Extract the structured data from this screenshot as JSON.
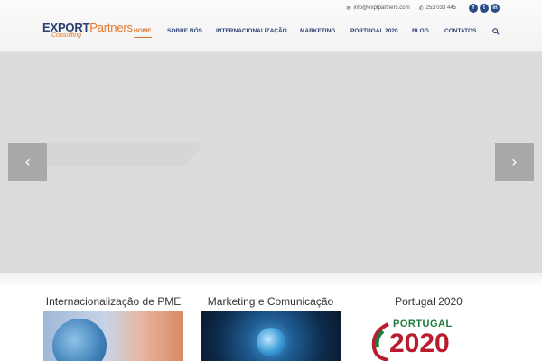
{
  "header": {
    "logo": {
      "export": "EXPORT",
      "partners": "Partners",
      "sub": "Consulting"
    },
    "contact": {
      "email": "info@exptpartners.com",
      "phone": "253 033 445"
    },
    "social": [
      "f",
      "t",
      "in"
    ],
    "nav": [
      {
        "label": "HOME",
        "active": true
      },
      {
        "label": "SOBRE NÓS",
        "active": false
      },
      {
        "label": "INTERNACIONALIZAÇÃO",
        "active": false
      },
      {
        "label": "MARKETING",
        "active": false
      },
      {
        "label": "PORTUGAL 2020",
        "active": false
      },
      {
        "label": "BLOG",
        "active": false
      },
      {
        "label": "CONTATOS",
        "active": false
      }
    ]
  },
  "slider": {
    "prev": "‹",
    "next": "›"
  },
  "features": [
    {
      "title": "Internacionalização de PME"
    },
    {
      "title": "Marketing e Comunicação"
    },
    {
      "title": "Portugal 2020",
      "image_text": {
        "word": "PORTUGAL",
        "year": "2020"
      }
    }
  ],
  "colors": {
    "brand_blue": "#2b3f73",
    "brand_orange": "#e6762a",
    "p2020_green": "#1e7a3c",
    "p2020_red": "#b91c2c"
  }
}
